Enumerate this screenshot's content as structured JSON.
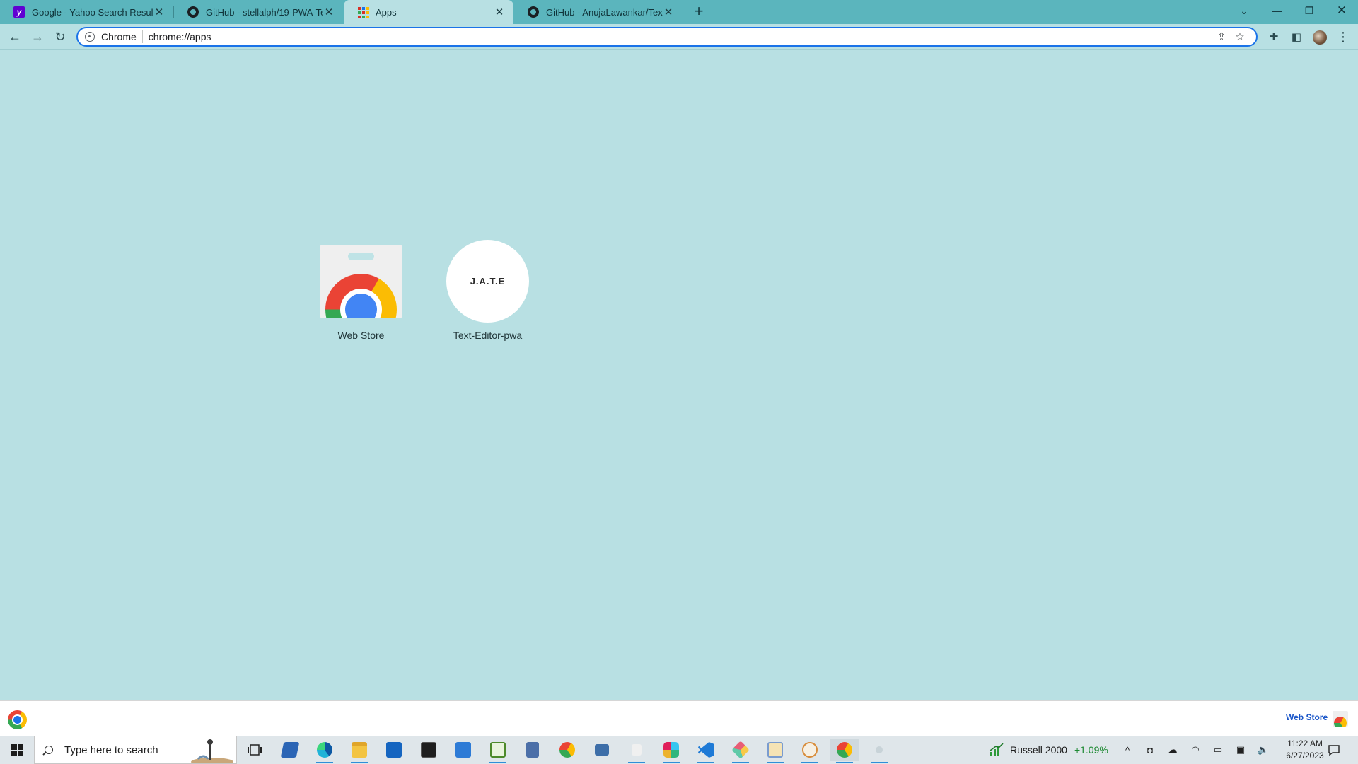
{
  "browser": {
    "tabs": [
      {
        "title": "Google - Yahoo Search Results",
        "favicon": "yahoo-icon",
        "active": false
      },
      {
        "title": "GitHub - stellalph/19-PWA-Text-E",
        "favicon": "github-icon",
        "active": false
      },
      {
        "title": "Apps",
        "favicon": "apps-grid-icon",
        "active": true
      },
      {
        "title": "GitHub - AnujaLawankar/Text-Ed",
        "favicon": "github-icon",
        "active": false
      }
    ],
    "omnibox": {
      "chip": "Chrome",
      "url": "chrome://apps"
    },
    "colors": {
      "frame": "#5bb5bd",
      "page": "#b8e0e3",
      "accent": "#1a73e8"
    }
  },
  "apps": [
    {
      "label": "Web Store",
      "icon": "chrome-web-store-icon"
    },
    {
      "label": "Text-Editor-pwa",
      "icon": "jate-icon",
      "icon_text": "J.A.T.E"
    }
  ],
  "shelf": {
    "link": "Web Store"
  },
  "taskbar": {
    "search_placeholder": "Type here to search",
    "ticker_name": "Russell 2000",
    "ticker_change": "+1.09%",
    "time": "11:22 AM",
    "date": "6/27/2023"
  }
}
